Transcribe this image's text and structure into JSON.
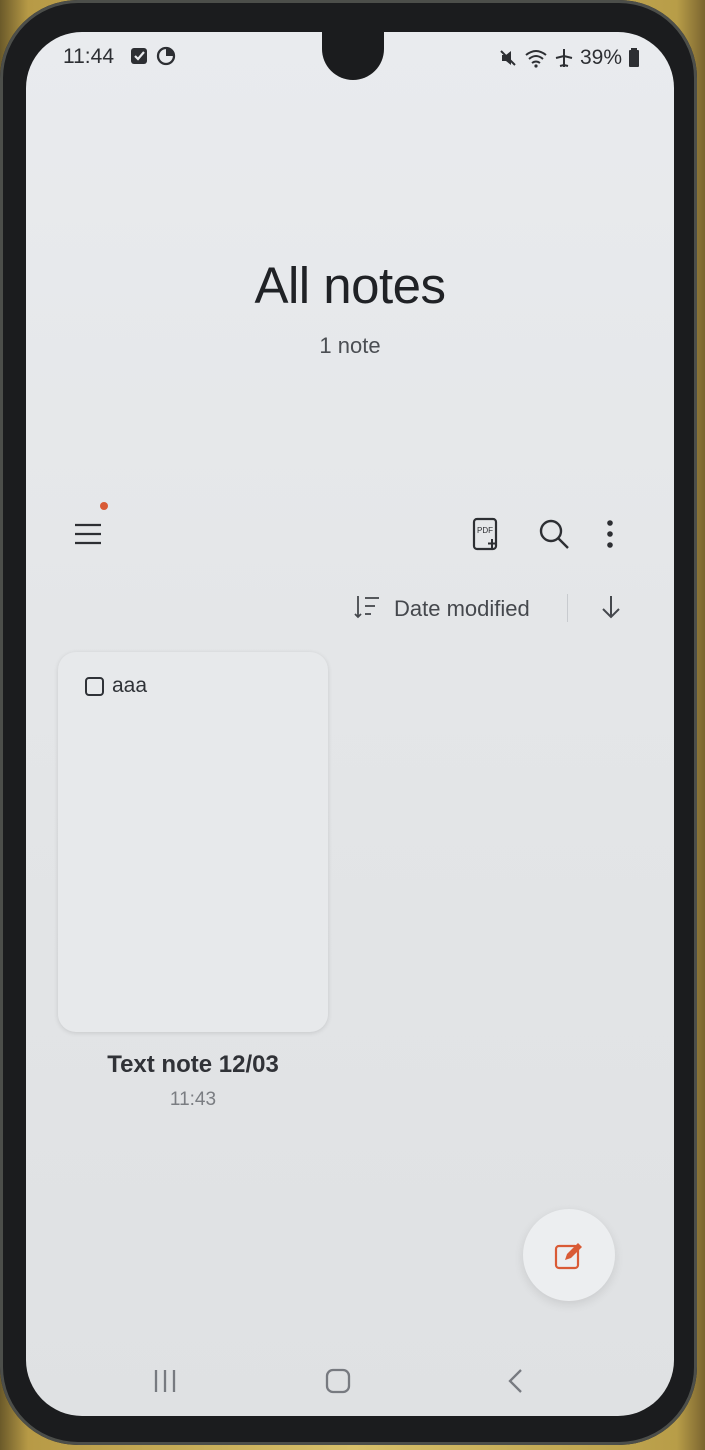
{
  "status_bar": {
    "time": "11:44",
    "battery": "39%",
    "left_icons": [
      "checkbox-notification-icon",
      "clock-icon"
    ],
    "right_icons": [
      "mute-icon",
      "wifi-icon",
      "airplane-icon",
      "battery-icon"
    ]
  },
  "header": {
    "title": "All notes",
    "count": "1 note"
  },
  "toolbar": {
    "icons": [
      "menu-icon",
      "pdf-add-icon",
      "search-icon",
      "more-options-icon"
    ],
    "notification_color": "#d95a35"
  },
  "sort": {
    "label": "Date modified",
    "direction": "descending"
  },
  "notes": [
    {
      "content": "aaa",
      "title": "Text note 12/03",
      "time": "11:43"
    }
  ],
  "fab": {
    "icon": "compose-icon",
    "accent_color": "#d95a35"
  },
  "navigation": [
    "recent-apps-icon",
    "home-icon",
    "back-icon"
  ]
}
